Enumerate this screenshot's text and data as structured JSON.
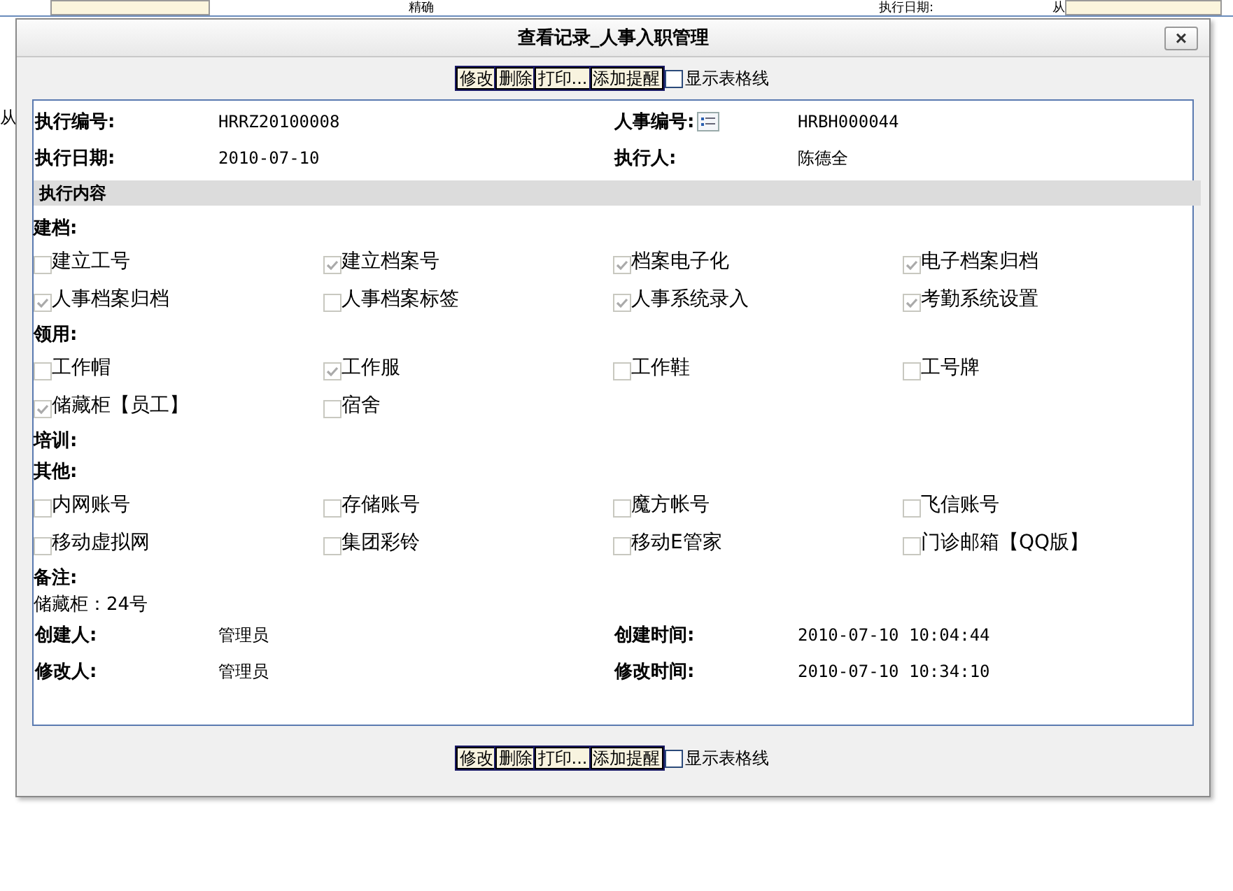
{
  "background": {
    "top_texts": [
      "精确",
      "执行日期:",
      "从"
    ],
    "left_text": "从"
  },
  "dialog": {
    "title": "查看记录_人事入职管理",
    "close": "×"
  },
  "toolbars": [
    {
      "buttons": [
        "修改",
        "删除",
        "打印...",
        "添加提醒"
      ],
      "gridlines": {
        "label": "显示表格线",
        "checked": false
      }
    },
    {
      "buttons": [
        "修改",
        "删除",
        "打印...",
        "添加提醒"
      ],
      "gridlines": {
        "label": "显示表格线",
        "checked": false
      }
    }
  ],
  "header_fields": [
    {
      "label": "执行编号:",
      "value": "HRRZ20100008"
    },
    {
      "label": "人事编号:",
      "value": "HRBH000044",
      "has_picker": true
    },
    {
      "label": "执行日期:",
      "value": "2010-07-10"
    },
    {
      "label": "执行人:",
      "value": "陈德全"
    }
  ],
  "section_title": "执行内容",
  "groups": [
    {
      "title": "建档:",
      "items": [
        {
          "label": "建立工号",
          "checked": false
        },
        {
          "label": "建立档案号",
          "checked": true
        },
        {
          "label": "档案电子化",
          "checked": true
        },
        {
          "label": "电子档案归档",
          "checked": true
        },
        {
          "label": "人事档案归档",
          "checked": true
        },
        {
          "label": "人事档案标签",
          "checked": false
        },
        {
          "label": "人事系统录入",
          "checked": true
        },
        {
          "label": "考勤系统设置",
          "checked": true
        }
      ]
    },
    {
      "title": "领用:",
      "items": [
        {
          "label": "工作帽",
          "checked": false
        },
        {
          "label": "工作服",
          "checked": true
        },
        {
          "label": "工作鞋",
          "checked": false
        },
        {
          "label": "工号牌",
          "checked": false
        },
        {
          "label": "储藏柜【员工】",
          "checked": true
        },
        {
          "label": "宿舍",
          "checked": false
        }
      ]
    },
    {
      "title": "培训:"
    },
    {
      "title": "其他:",
      "items": [
        {
          "label": "内网账号",
          "checked": false
        },
        {
          "label": "存储账号",
          "checked": false
        },
        {
          "label": "魔方帐号",
          "checked": false
        },
        {
          "label": "飞信账号",
          "checked": false
        },
        {
          "label": "移动虚拟网",
          "checked": false
        },
        {
          "label": "集团彩铃",
          "checked": false
        },
        {
          "label": "移动E管家",
          "checked": false
        },
        {
          "label": "门诊邮箱【QQ版】",
          "checked": false
        }
      ]
    }
  ],
  "note": {
    "label": "备注:",
    "text": "储藏柜：24号"
  },
  "footer_fields": [
    {
      "label": "创建人:",
      "value": "管理员"
    },
    {
      "label": "创建时间:",
      "value": "2010-07-10 10:04:44"
    },
    {
      "label": "修改人:",
      "value": "管理员"
    },
    {
      "label": "修改时间:",
      "value": "2010-07-10 10:34:10"
    }
  ]
}
